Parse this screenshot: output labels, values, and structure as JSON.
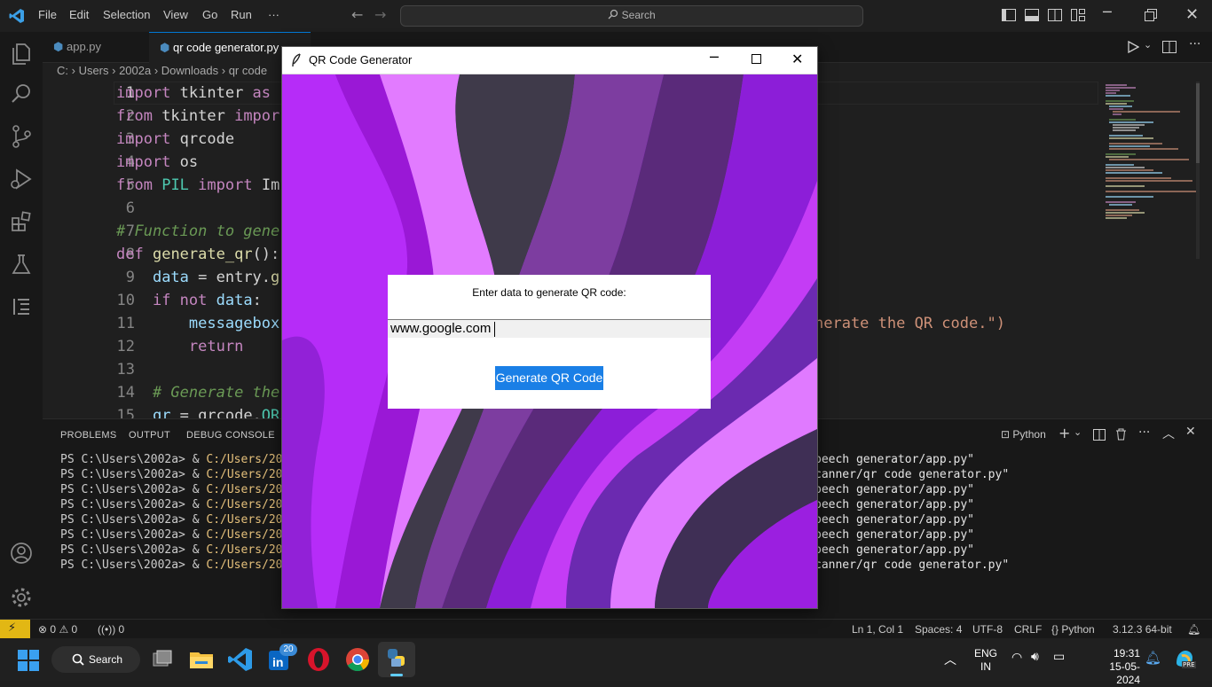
{
  "menu": [
    "File",
    "Edit",
    "Selection",
    "View",
    "Go",
    "Run",
    "···"
  ],
  "search": {
    "label": "Search"
  },
  "tabs": [
    {
      "label": "app.py",
      "active": false
    },
    {
      "label": "qr code generator.py",
      "active": true
    }
  ],
  "breadcrumb": [
    "C:",
    "Users",
    "2002a",
    "Downloads",
    "qr code"
  ],
  "editor": {
    "line_numbers": [
      "1",
      "2",
      "3",
      "4",
      "5",
      "6",
      "7",
      "8",
      "9",
      "10",
      "11",
      "12",
      "13",
      "14",
      "15"
    ],
    "code_overflow_right": "nerate the QR code.\")"
  },
  "panel": {
    "tabs": [
      "PROBLEMS",
      "OUTPUT",
      "DEBUG CONSOLE"
    ],
    "terminal_label": "Python",
    "lines_left": [
      {
        "prompt": "PS C:\\Users\\2002a> & ",
        "path": "C:/Users/2002a/"
      },
      {
        "prompt": "PS C:\\Users\\2002a> & ",
        "path": "C:/Users/2002a/"
      },
      {
        "prompt": "PS C:\\Users\\2002a> & ",
        "path": "C:/Users/2002a/"
      },
      {
        "prompt": "PS C:\\Users\\2002a> & ",
        "path": "C:/Users/2002a/"
      },
      {
        "prompt": "PS C:\\Users\\2002a> & ",
        "path": "C:/Users/2002a/"
      },
      {
        "prompt": "PS C:\\Users\\2002a> & ",
        "path": "C:/Users/2002a/"
      },
      {
        "prompt": "PS C:\\Users\\2002a> & ",
        "path": "C:/Users/2002a/"
      },
      {
        "prompt": "PS C:\\Users\\2002a> & ",
        "path": "C:/Users/2002a/"
      }
    ],
    "lines_right": [
      "peech generator/app.py\"",
      "canner/qr code generator.py\"",
      "peech generator/app.py\"",
      "peech generator/app.py\"",
      "peech generator/app.py\"",
      "peech generator/app.py\"",
      "peech generator/app.py\"",
      "canner/qr code generator.py\""
    ]
  },
  "statusbar": {
    "errors": "0",
    "warnings": "0",
    "ports": "0",
    "position": "Ln 1, Col 1",
    "spaces": "Spaces: 4",
    "encoding": "UTF-8",
    "eol": "CRLF",
    "language": "Python",
    "interpreter": "3.12.3 64-bit"
  },
  "taskbar": {
    "search_label": "Search",
    "linkedin_badge": "20",
    "lang_top": "ENG",
    "lang_bottom": "IN",
    "time": "19:31",
    "date": "15-05-2024",
    "copilot_badge": "PRE"
  },
  "tk": {
    "title": "QR Code Generator",
    "label": "Enter data to generate QR code:",
    "entry_value": "www.google.com",
    "button": "Generate QR Code"
  },
  "colors": {
    "accent": "#0078d4",
    "tk_button": "#1a7fe6",
    "purple_bg": "#a020f0"
  }
}
